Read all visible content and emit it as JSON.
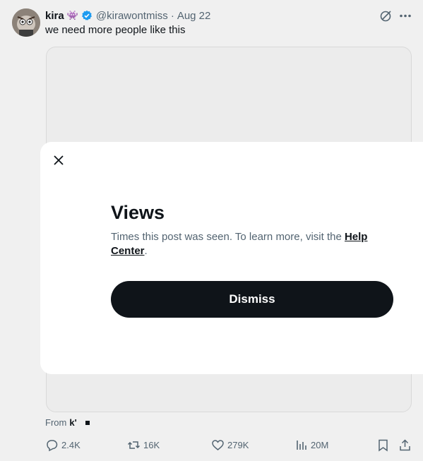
{
  "tweet": {
    "author_name": "kira",
    "author_emoji": "👾",
    "handle": "@kirawontmiss",
    "separator": "·",
    "date": "Aug 22",
    "text": "we need more people like this",
    "from_prefix": "From",
    "from_logo": "k'"
  },
  "icons": {
    "verified": "verified-badge-icon",
    "grok": "grok-icon",
    "more": "more-icon",
    "close": "close-icon"
  },
  "actions": {
    "replies": "2.4K",
    "reposts": "16K",
    "likes": "279K",
    "views": "20M"
  },
  "modal": {
    "title": "Views",
    "body_text": "Times this post was seen. To learn more, visit the ",
    "link_text": "Help Center",
    "body_end": ".",
    "button_label": "Dismiss"
  },
  "colors": {
    "verified": "#1d9bf0",
    "button_bg": "#0f1419",
    "muted_text": "#536471"
  }
}
